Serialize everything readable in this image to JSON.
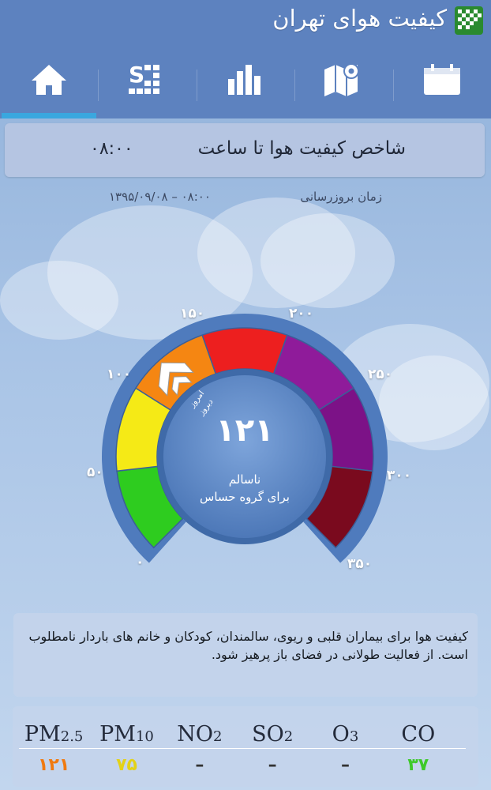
{
  "app": {
    "title": "کیفیت هوای تهران",
    "logo_icon": "checkered-leaf-logo"
  },
  "tabs": [
    {
      "name": "home",
      "icon": "home-icon",
      "active": true
    },
    {
      "name": "pollutants",
      "icon": "stats-grid-icon",
      "active": false
    },
    {
      "name": "chart",
      "icon": "bar-chart-icon",
      "active": false
    },
    {
      "name": "map",
      "icon": "map-pin-icon",
      "active": false
    },
    {
      "name": "calendar",
      "icon": "calendar-icon",
      "active": false
    }
  ],
  "index_panel": {
    "title": "شاخص کیفیت هوا تا ساعت",
    "time": "۰۸:۰۰"
  },
  "update": {
    "label": "زمان بروزرسانی",
    "value": "۱۳۹۵/۰۹/۰۸ – ۰۸:۰۰"
  },
  "gauge": {
    "value": "۱۲۱",
    "level": 121,
    "min": 0,
    "max": 350,
    "status_line1": "ناسالم",
    "status_line2": "برای گروه حساس",
    "today_label": "امروز",
    "yesterday_label": "دیروز",
    "ticks": [
      "۰",
      "۵۰",
      "۱۰۰",
      "۱۵۰",
      "۲۰۰",
      "۲۵۰",
      "۳۰۰",
      "۳۵۰"
    ],
    "segment_colors": [
      "#2ecc1f",
      "#f5ea16",
      "#f58612",
      "#ed1f1f",
      "#8f1b9a",
      "#7c1287",
      "#7a0a1e"
    ]
  },
  "description": "کیفیت هوا برای بیماران قلبی و ریوی، سالمندان، کودکان و خانم های باردار نامطلوب است. از فعالیت طولانی در فضای باز پرهیز شود.",
  "pollutants": [
    {
      "name": "PM",
      "sub": "2.5",
      "value": "۱۲۱",
      "color": "#f07a10"
    },
    {
      "name": "PM",
      "sub": "10",
      "value": "۷۵",
      "color": "#e3d217"
    },
    {
      "name": "NO",
      "sub": "2",
      "value": "–",
      "color": "#333333"
    },
    {
      "name": "SO",
      "sub": "2",
      "value": "–",
      "color": "#333333"
    },
    {
      "name": "O",
      "sub": "3",
      "value": "–",
      "color": "#333333"
    },
    {
      "name": "CO",
      "sub": "",
      "value": "۳۷",
      "color": "#3ec92a"
    }
  ]
}
